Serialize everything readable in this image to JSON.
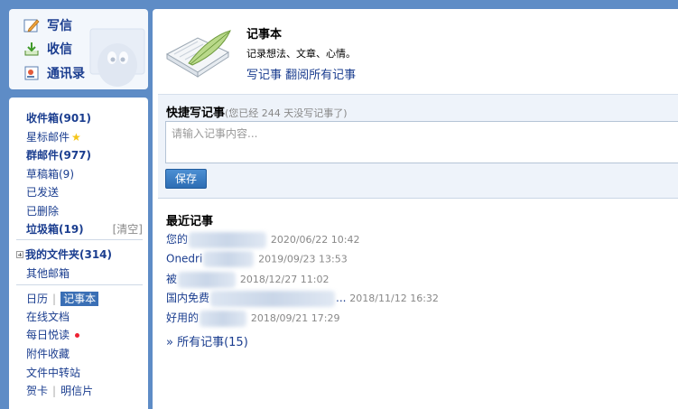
{
  "compose": {
    "write": "写信",
    "receive": "收信",
    "contacts": "通讯录"
  },
  "folders": {
    "inbox": "收件箱(901)",
    "starred": "星标邮件",
    "group": "群邮件(977)",
    "drafts": "草稿箱(9)",
    "sent": "已发送",
    "deleted": "已删除",
    "spam": "垃圾箱(19)",
    "spam_clear": "[清空]",
    "my_folders": "我的文件夹(314)",
    "other": "其他邮箱",
    "calendar": "日历",
    "notebook": "记事本",
    "online_docs": "在线文档",
    "daily_read": "每日悦读",
    "attachments": "附件收藏",
    "file_transfer": "文件中转站",
    "card": "贺卡",
    "postcard": "明信片"
  },
  "notebook": {
    "title": "记事本",
    "subtitle": "记录想法、文章、心情。",
    "write_link": "写记事",
    "browse_link": "翻阅所有记事"
  },
  "quick": {
    "title": "快捷写记事",
    "note": "(您已经 244 天没写记事了)",
    "placeholder": "请输入记事内容...",
    "save": "保存"
  },
  "recent": {
    "title": "最近记事",
    "items": [
      {
        "prefix": "您的",
        "date": "2020/06/22 10:42"
      },
      {
        "prefix": "Onedri",
        "date": "2019/09/23 13:53"
      },
      {
        "prefix": "被",
        "date": "2018/12/27 11:02"
      },
      {
        "prefix": "国内免费",
        "suffix": "...",
        "date": "2018/11/12 16:32"
      },
      {
        "prefix": "好用的",
        "date": "2018/09/21 17:29"
      }
    ],
    "all": "» 所有记事(15)"
  }
}
